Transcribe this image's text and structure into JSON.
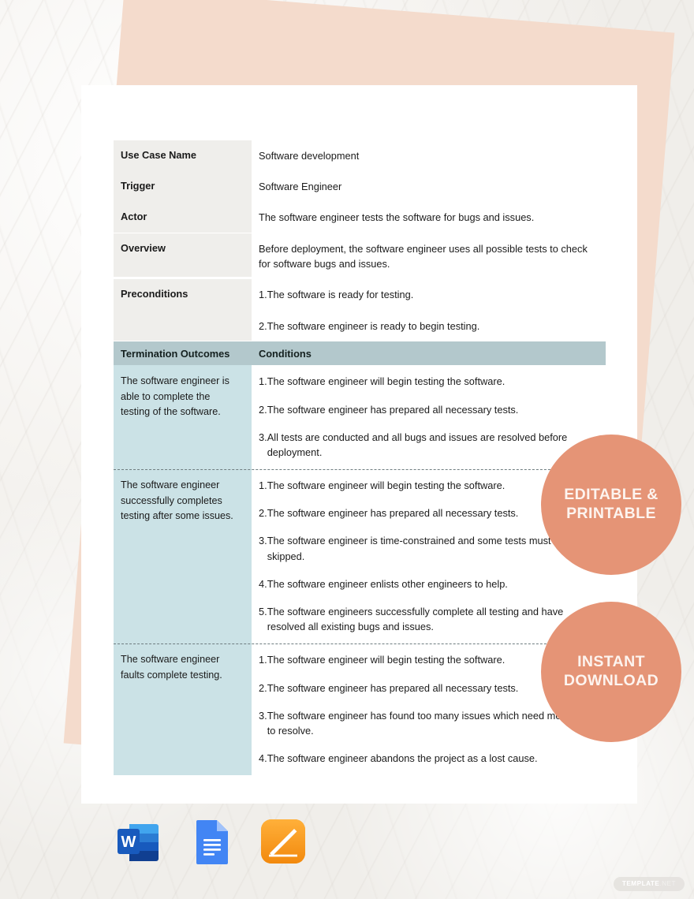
{
  "document": {
    "type": "use-case-template",
    "info_rows": [
      {
        "label": "Use Case Name",
        "values": [
          "Software development"
        ]
      },
      {
        "label": "Trigger",
        "values": [
          "Software Engineer"
        ]
      },
      {
        "label": "Actor",
        "values": [
          "The software engineer tests the software for bugs and issues."
        ]
      },
      {
        "label": "Overview",
        "values": [
          "Before deployment, the software engineer uses all possible tests to check for software bugs and issues."
        ]
      },
      {
        "label": "Preconditions",
        "values": [
          "1.The software is ready for testing.",
          "2.The software engineer is ready to begin testing."
        ]
      }
    ],
    "outcome_header": {
      "outcomes_label": "Termination Outcomes",
      "conditions_label": "Conditions"
    },
    "outcomes": [
      {
        "outcome": "The software engineer is able to complete the testing of the software.",
        "conditions": [
          {
            "num": "1.",
            "text": "The software engineer will begin testing the software."
          },
          {
            "num": "2.",
            "text": "The software engineer has prepared all necessary tests."
          },
          {
            "num": "3.",
            "text": "All tests are conducted and all bugs and issues are resolved before deployment."
          }
        ]
      },
      {
        "outcome": "The software engineer successfully completes testing after some issues.",
        "conditions": [
          {
            "num": "1.",
            "text": "The software engineer will begin testing the software."
          },
          {
            "num": "2.",
            "text": "The software engineer has prepared all necessary tests."
          },
          {
            "num": "3.",
            "text": "The software engineer is time-constrained and some tests must be skipped."
          },
          {
            "num": "4.",
            "text": "The software engineer enlists other engineers to help."
          },
          {
            "num": "5.",
            "text": "The software engineers successfully complete all testing and have resolved all existing bugs and issues."
          }
        ]
      },
      {
        "outcome": "The software engineer faults complete testing.",
        "conditions": [
          {
            "num": "1.",
            "text": "The software engineer will begin testing the software."
          },
          {
            "num": "2.",
            "text": "The software engineer has prepared all necessary tests."
          },
          {
            "num": "3.",
            "text": "The software engineer has found too many issues which need more time to resolve."
          },
          {
            "num": "4.",
            "text": "The software engineer abandons the project as a lost cause."
          }
        ]
      }
    ]
  },
  "promos": [
    {
      "id": "editable",
      "line1": "EDITABLE &",
      "line2": "PRINTABLE"
    },
    {
      "id": "download",
      "line1": "INSTANT",
      "line2": "DOWNLOAD"
    }
  ],
  "format_icons": [
    {
      "name": "microsoft-word-icon",
      "label": "W"
    },
    {
      "name": "google-docs-icon",
      "label": ""
    },
    {
      "name": "apple-pages-icon",
      "label": ""
    }
  ],
  "watermark": {
    "primary": "TEMPLATE",
    "secondary": ".NET"
  },
  "colors": {
    "label_column": "#efeeeb",
    "outcome_header_band": "#b3c8cc",
    "outcome_column": "#cbe2e6",
    "promo_circle": "#e59476",
    "peach_sheet": "#f4dbcc",
    "page": "#ffffff",
    "text": "#1b1b1b"
  }
}
